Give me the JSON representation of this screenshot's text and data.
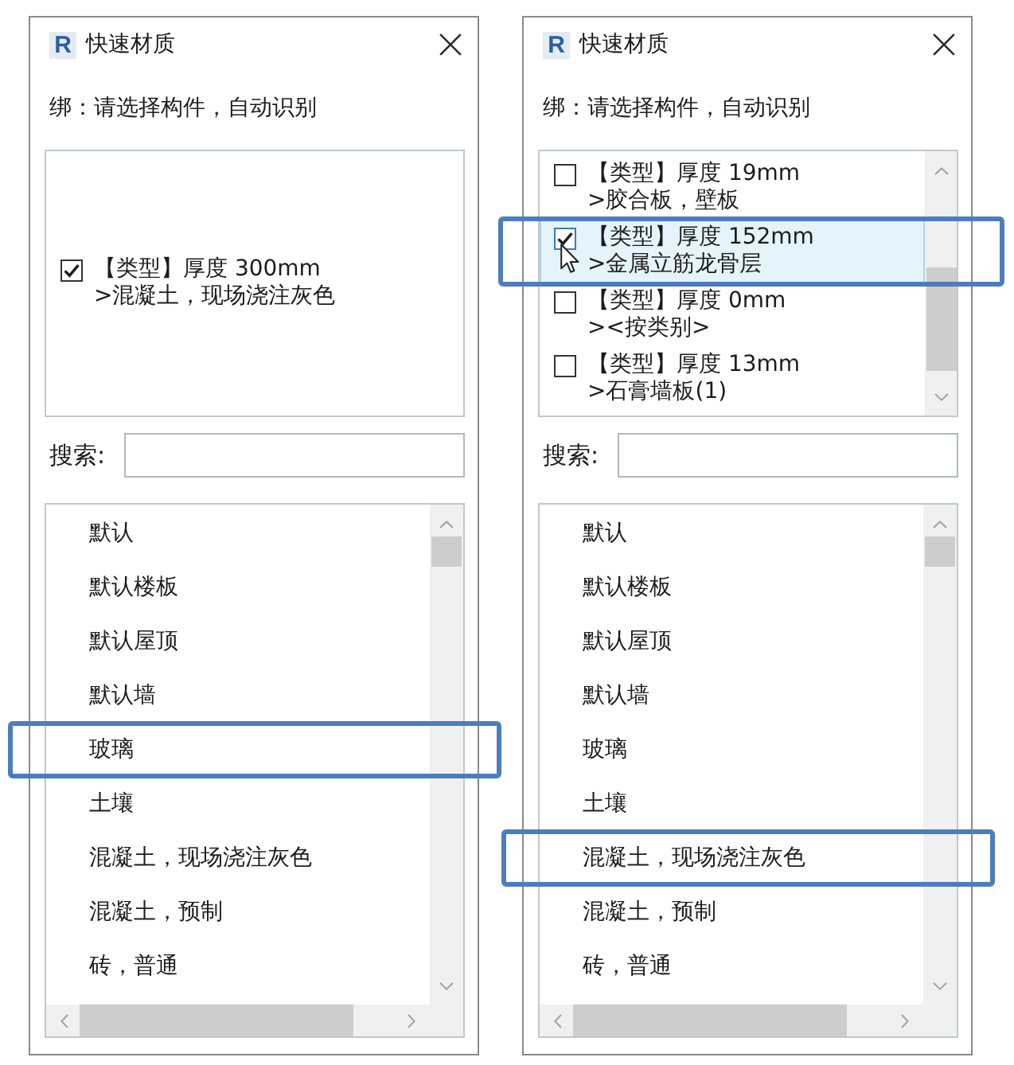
{
  "panels": [
    {
      "icon": "R",
      "title": "快速材质",
      "hint": "绑：请选择构件，自动识别",
      "layer_scrollbar": false,
      "layers": [
        {
          "type": "【类型】厚度 300mm",
          "material": ">混凝土，现场浇注灰色",
          "checked": true,
          "selected": false,
          "hover": false,
          "annotated": false
        }
      ],
      "search": {
        "label": "搜索:"
      },
      "materials": [
        {
          "label": "默认",
          "annotated": false
        },
        {
          "label": "默认楼板",
          "annotated": false
        },
        {
          "label": "默认屋顶",
          "annotated": false
        },
        {
          "label": "默认墙",
          "annotated": false
        },
        {
          "label": "玻璃",
          "annotated": true
        },
        {
          "label": "土壤",
          "annotated": false
        },
        {
          "label": "混凝土，现场浇注灰色",
          "annotated": false
        },
        {
          "label": "混凝土，预制",
          "annotated": false
        },
        {
          "label": "砖，普通",
          "annotated": false
        }
      ]
    },
    {
      "icon": "R",
      "title": "快速材质",
      "hint": "绑：请选择构件，自动识别",
      "layer_scrollbar": true,
      "layers": [
        {
          "type": "【类型】厚度 19mm",
          "material": ">胶合板，壁板",
          "checked": false,
          "selected": false,
          "hover": false,
          "annotated": false
        },
        {
          "type": "【类型】厚度 152mm",
          "material": ">金属立筋龙骨层",
          "checked": true,
          "selected": true,
          "hover": true,
          "annotated": true
        },
        {
          "type": "【类型】厚度 0mm",
          "material": "><按类别>",
          "checked": false,
          "selected": false,
          "hover": false,
          "annotated": false
        },
        {
          "type": "【类型】厚度 13mm",
          "material": ">石膏墙板(1)",
          "checked": false,
          "selected": false,
          "hover": false,
          "annotated": false
        }
      ],
      "search": {
        "label": "搜索:"
      },
      "materials": [
        {
          "label": "默认",
          "annotated": false
        },
        {
          "label": "默认楼板",
          "annotated": false
        },
        {
          "label": "默认屋顶",
          "annotated": false
        },
        {
          "label": "默认墙",
          "annotated": false
        },
        {
          "label": "玻璃",
          "annotated": false
        },
        {
          "label": "土壤",
          "annotated": false
        },
        {
          "label": "混凝土，现场浇注灰色",
          "annotated": true
        },
        {
          "label": "混凝土，预制",
          "annotated": false
        },
        {
          "label": "砖，普通",
          "annotated": false
        }
      ]
    }
  ]
}
